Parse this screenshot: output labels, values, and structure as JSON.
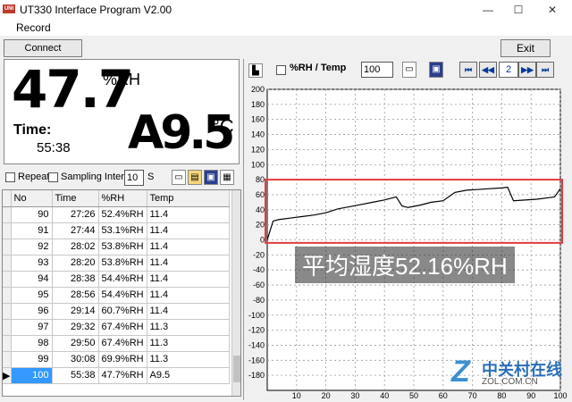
{
  "window": {
    "title": "UT330 Interface Program V2.00",
    "minimize": "—",
    "maximize": "☐",
    "close": "✕",
    "icon_text": "UNI-T"
  },
  "menu": {
    "record": "Record"
  },
  "toolbar": {
    "connect": "Connect",
    "exit": "Exit"
  },
  "readout": {
    "humidity": "47.7",
    "humidity_unit": "%RH",
    "time_label": "Time:",
    "time_value": "55:38",
    "temperature": "A9.5",
    "temperature_unit": "°C"
  },
  "controls": {
    "repeat_label": "Repeat",
    "sampling_label": "Sampling Interval",
    "interval_value": "10",
    "interval_unit": "S",
    "icons": [
      "new-file-icon",
      "open-folder-icon",
      "save-disk-icon",
      "print-icon"
    ]
  },
  "table": {
    "columns": [
      "No",
      "Time",
      "%RH",
      "Temp"
    ],
    "rows": [
      {
        "no": "90",
        "time": "27:26",
        "rh": "52.4%RH",
        "temp": "11.4"
      },
      {
        "no": "91",
        "time": "27:44",
        "rh": "53.1%RH",
        "temp": "11.4"
      },
      {
        "no": "92",
        "time": "28:02",
        "rh": "53.8%RH",
        "temp": "11.4"
      },
      {
        "no": "93",
        "time": "28:20",
        "rh": "53.8%RH",
        "temp": "11.4"
      },
      {
        "no": "94",
        "time": "28:38",
        "rh": "54.4%RH",
        "temp": "11.4"
      },
      {
        "no": "95",
        "time": "28:56",
        "rh": "54.4%RH",
        "temp": "11.4"
      },
      {
        "no": "96",
        "time": "29:14",
        "rh": "60.7%RH",
        "temp": "11.4"
      },
      {
        "no": "97",
        "time": "29:32",
        "rh": "67.4%RH",
        "temp": "11.3"
      },
      {
        "no": "98",
        "time": "29:50",
        "rh": "67.4%RH",
        "temp": "11.3"
      },
      {
        "no": "99",
        "time": "30:08",
        "rh": "69.9%RH",
        "temp": "11.3"
      },
      {
        "no": "100",
        "time": "55:38",
        "rh": "47.7%RH",
        "temp": "A9.5"
      }
    ],
    "selected_index": 10
  },
  "chart_toolbar": {
    "series_label": "%RH / Temp",
    "count": "100",
    "page": "2",
    "nav": [
      "⏮",
      "◀◀",
      "▶▶",
      "⏭"
    ]
  },
  "chart_data": {
    "type": "line",
    "title": "",
    "xlabel": "",
    "ylabel": "",
    "xlim": [
      0,
      100
    ],
    "ylim": [
      -200,
      200
    ],
    "xticks": [
      10,
      20,
      30,
      40,
      50,
      60,
      70,
      80,
      90,
      100
    ],
    "yticks": [
      200,
      180,
      160,
      140,
      120,
      100,
      80,
      60,
      40,
      20,
      0,
      -20,
      -40,
      -60,
      -80,
      -100,
      -120,
      -140,
      -160,
      -180
    ],
    "grid": true,
    "series": [
      {
        "color": "#000000",
        "x": [
          0,
          2,
          4,
          8,
          12,
          16,
          20,
          24,
          28,
          32,
          36,
          40,
          44,
          46,
          48,
          52,
          56,
          60,
          64,
          68,
          72,
          76,
          80,
          82,
          84,
          88,
          92,
          96,
          98,
          100
        ],
        "values": [
          0,
          25,
          27,
          29,
          31,
          33,
          36,
          41,
          44,
          47,
          50,
          53,
          57,
          45,
          43,
          46,
          50,
          52,
          63,
          66,
          67,
          68,
          69,
          70,
          52,
          53,
          54,
          56,
          57,
          68
        ]
      }
    ]
  },
  "overlay": {
    "text": "平均湿度52.16%RH",
    "color": "#e03c3c"
  },
  "watermark": {
    "cn": "中关村在线",
    "en": "ZOL.COM.CN"
  }
}
